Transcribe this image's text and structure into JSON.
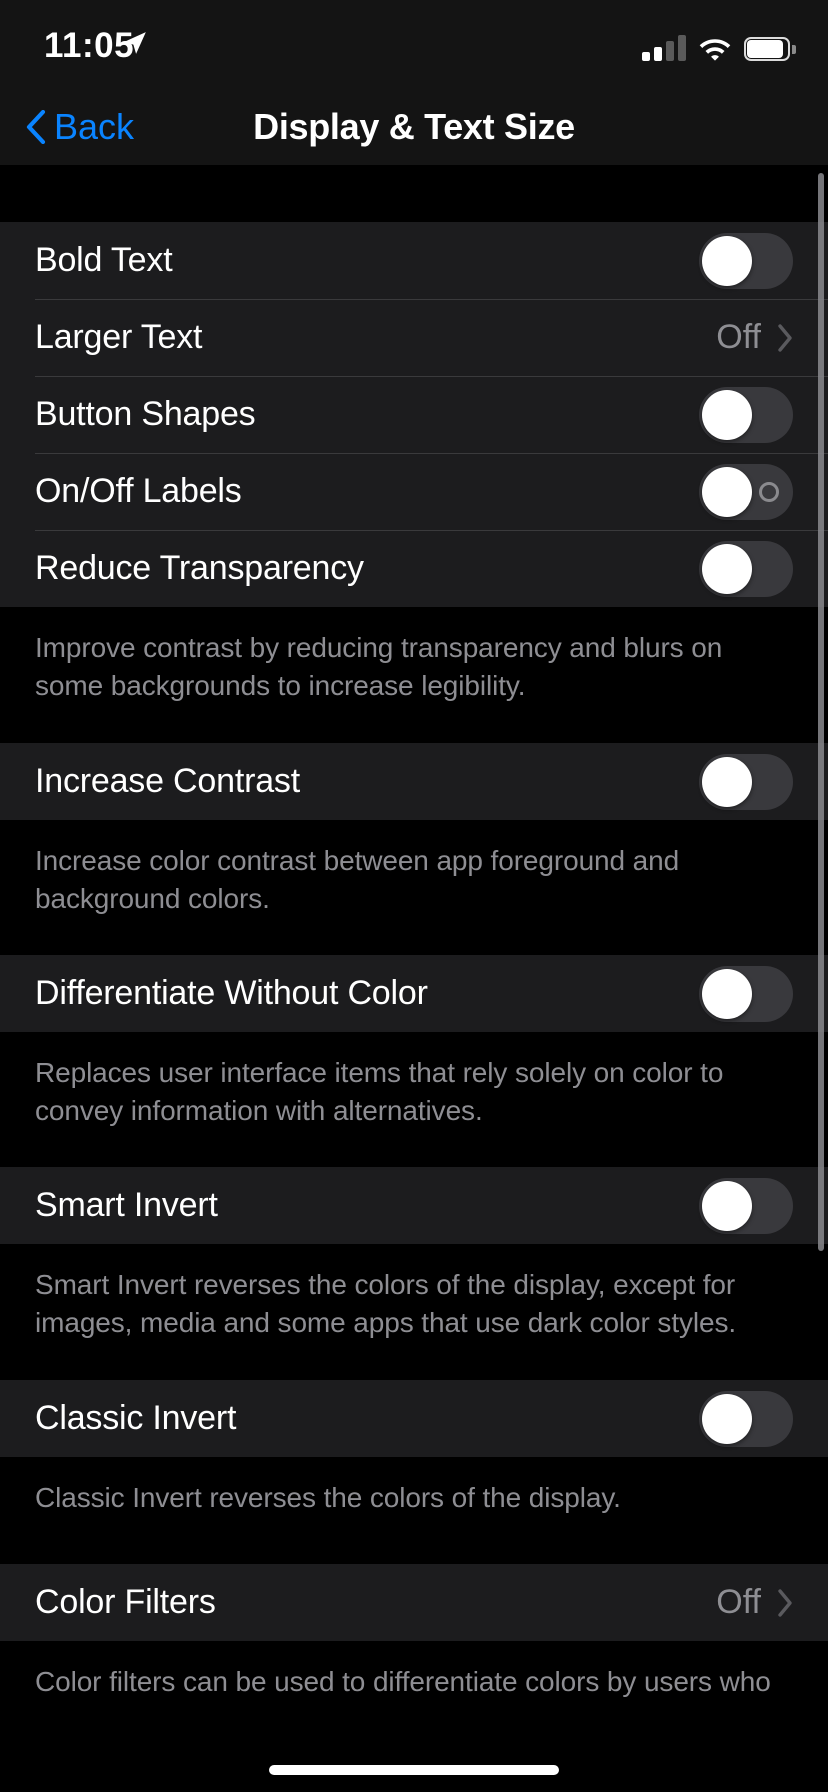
{
  "status_bar": {
    "time": "11:05",
    "location_icon": "location-arrow-icon",
    "cellular_icon": "cellular-signal-icon",
    "cellular_bars_active": 2,
    "cellular_bars_total": 4,
    "wifi_icon": "wifi-icon",
    "battery_icon": "battery-icon",
    "battery_level_percent": 95
  },
  "nav_bar": {
    "back_label": "Back",
    "back_icon": "chevron-left-icon",
    "title": "Display & Text Size",
    "accent_color": "#0a84ff"
  },
  "sections": [
    {
      "rows": [
        {
          "label": "Bold Text",
          "type": "toggle",
          "value": "off"
        },
        {
          "label": "Larger Text",
          "type": "disclosure",
          "value": "Off",
          "icon": "chevron-right-icon"
        },
        {
          "label": "Button Shapes",
          "type": "toggle",
          "value": "off"
        },
        {
          "label": "On/Off Labels",
          "type": "toggle",
          "value": "off",
          "off_mark": "circle-off-label-icon"
        },
        {
          "label": "Reduce Transparency",
          "type": "toggle",
          "value": "off"
        }
      ],
      "footer": "Improve contrast by reducing transparency and blurs on some backgrounds to increase legibility."
    },
    {
      "rows": [
        {
          "label": "Increase Contrast",
          "type": "toggle",
          "value": "off"
        }
      ],
      "footer": "Increase color contrast between app foreground and background colors."
    },
    {
      "rows": [
        {
          "label": "Differentiate Without Color",
          "type": "toggle",
          "value": "off"
        }
      ],
      "footer": "Replaces user interface items that rely solely on color to convey information with alternatives."
    },
    {
      "rows": [
        {
          "label": "Smart Invert",
          "type": "toggle",
          "value": "off"
        }
      ],
      "footer": "Smart Invert reverses the colors of the display, except for images, media and some apps that use dark color styles."
    },
    {
      "rows": [
        {
          "label": "Classic Invert",
          "type": "toggle",
          "value": "off"
        }
      ],
      "footer": "Classic Invert reverses the colors of the display."
    },
    {
      "rows": [
        {
          "label": "Color Filters",
          "type": "disclosure",
          "value": "Off",
          "icon": "chevron-right-icon"
        }
      ],
      "footer": "Color filters can be used to differentiate colors by users who"
    }
  ],
  "colors": {
    "row_background": "#1c1c1e",
    "page_background": "#000000",
    "separator": "#3a3a3c",
    "secondary_text": "#8e8e93",
    "toggle_track_off": "#39393d",
    "toggle_knob": "#ffffff"
  }
}
